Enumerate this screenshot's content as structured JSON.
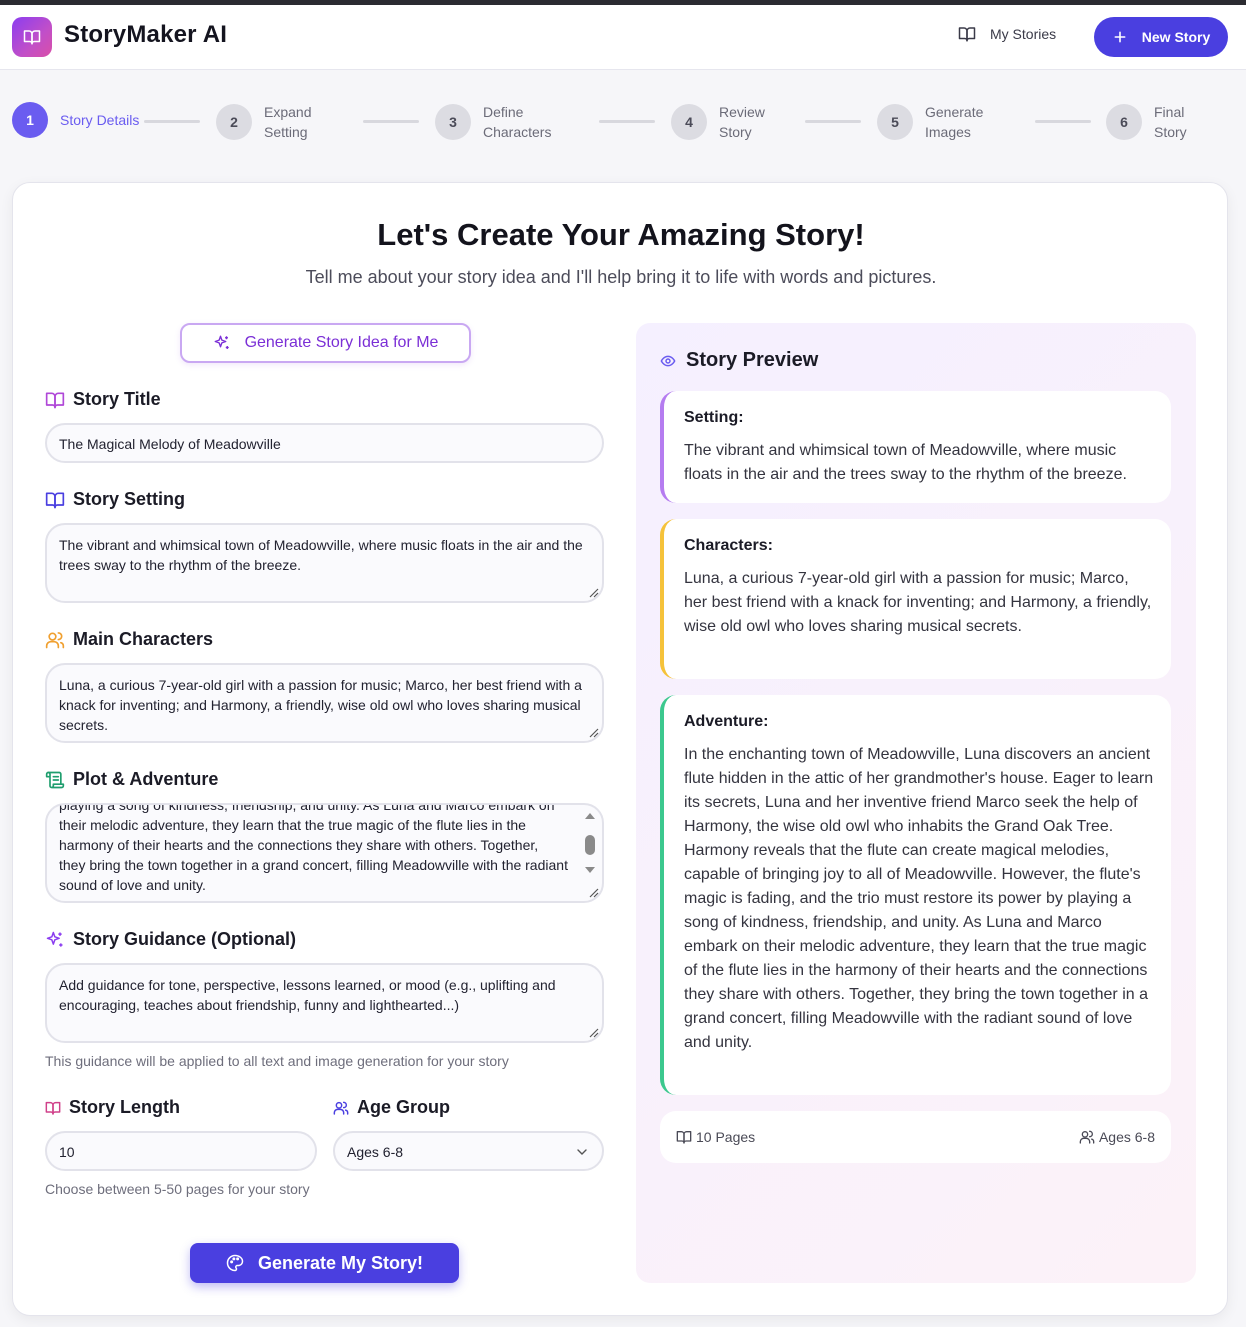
{
  "app": {
    "title": "StoryMaker AI",
    "my_stories": "My Stories",
    "new_story": "New Story"
  },
  "steps": [
    {
      "num": "1",
      "label": "Story Details"
    },
    {
      "num": "2",
      "label": "Expand Setting"
    },
    {
      "num": "3",
      "label": "Define Characters"
    },
    {
      "num": "4",
      "label": "Review Story"
    },
    {
      "num": "5",
      "label": "Generate Images"
    },
    {
      "num": "6",
      "label": "Final Story"
    }
  ],
  "main": {
    "headline": "Let's Create Your Amazing Story!",
    "subline": "Tell me about your story idea and I'll help bring it to life with words and pictures.",
    "generate_idea": "Generate Story Idea for Me"
  },
  "form": {
    "title_label": "Story Title",
    "title_value": "The Magical Melody of Meadowville",
    "setting_label": "Story Setting",
    "setting_value": "The vibrant and whimsical town of Meadowville, where music floats in the air and the trees sway to the rhythm of the breeze.",
    "characters_label": "Main Characters",
    "characters_value": "Luna, a curious 7-year-old girl with a passion for music; Marco, her best friend with a knack for inventing; and Harmony, a friendly, wise old owl who loves sharing musical secrets.",
    "plot_label": "Plot & Adventure",
    "plot_value": "playing a song of kindness, friendship, and unity. As Luna and Marco embark on their melodic adventure, they learn that the true magic of the flute lies in the harmony of their hearts and the connections they share with others. Together, they bring the town together in a grand concert, filling Meadowville with the radiant sound of love and unity.",
    "guidance_label": "Story Guidance (Optional)",
    "guidance_placeholder": "Add guidance for tone, perspective, lessons learned, or mood (e.g., uplifting and encouraging, teaches about friendship, funny and lighthearted...)",
    "guidance_helper": "This guidance will be applied to all text and image generation for your story",
    "length_label": "Story Length",
    "length_value": "10",
    "length_helper": "Choose between 5-50 pages for your story",
    "age_label": "Age Group",
    "age_value": "Ages 6-8",
    "generate_button": "Generate My Story!"
  },
  "preview": {
    "title": "Story Preview",
    "setting_heading": "Setting:",
    "setting_text": "The vibrant and whimsical town of Meadowville, where music floats in the air and the trees sway to the rhythm of the breeze.",
    "characters_heading": "Characters:",
    "characters_text": "Luna, a curious 7-year-old girl with a passion for music; Marco, her best friend with a knack for inventing; and Harmony, a friendly, wise old owl who loves sharing musical secrets.",
    "adventure_heading": "Adventure:",
    "adventure_text": "In the enchanting town of Meadowville, Luna discovers an ancient flute hidden in the attic of her grandmother's house. Eager to learn its secrets, Luna and her inventive friend Marco seek the help of Harmony, the wise old owl who inhabits the Grand Oak Tree. Harmony reveals that the flute can create magical melodies, capable of bringing joy to all of Meadowville. However, the flute's magic is fading, and the trio must restore its power by playing a song of kindness, friendship, and unity. As Luna and Marco embark on their melodic adventure, they learn that the true magic of the flute lies in the harmony of their hearts and the connections they share with others. Together, they bring the town together in a grand concert, filling Meadowville with the radiant sound of love and unity.",
    "pages": "10 Pages",
    "ages": "Ages 6-8"
  },
  "colors": {
    "accent": "#4a3fe0",
    "setting_border": "#b57cf0",
    "characters_border": "#f5c23a",
    "adventure_border": "#3cc88e"
  }
}
